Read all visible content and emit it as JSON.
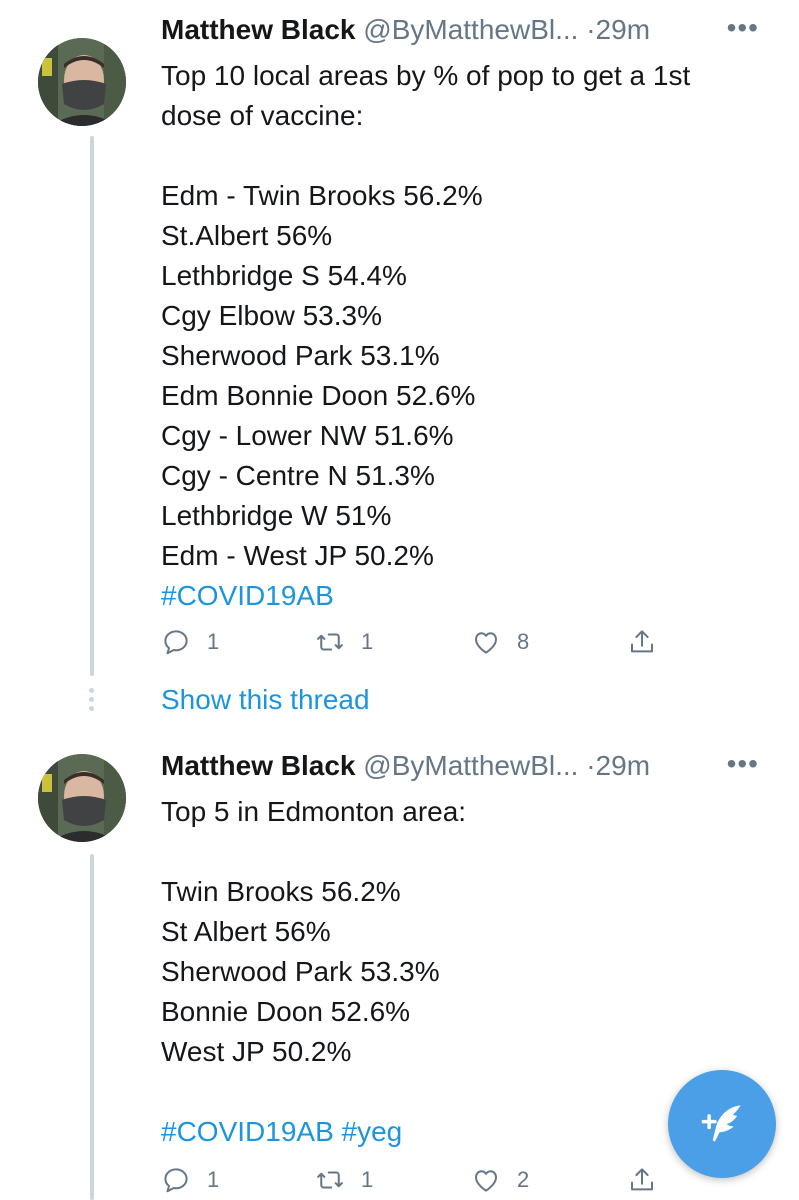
{
  "tweets": [
    {
      "name": "Matthew Black",
      "handle": "@ByMatthewBl...",
      "time": "·29m",
      "more": "•••",
      "lines": [
        "Top 10 local areas by % of pop to get a 1st",
        "dose of vaccine:",
        "",
        "Edm - Twin Brooks 56.2%",
        "St.Albert 56%",
        "Lethbridge S 54.4%",
        "Cgy Elbow 53.3%",
        "Sherwood Park 53.1%",
        "Edm Bonnie Doon 52.6%",
        "Cgy - Lower NW 51.6%",
        "Cgy - Centre N 51.3%",
        "Lethbridge W 51%",
        "Edm - West JP 50.2%"
      ],
      "hashtags": "#COVID19AB",
      "reply_count": "1",
      "retweet_count": "1",
      "like_count": "8"
    },
    {
      "name": "Matthew Black",
      "handle": "@ByMatthewBl...",
      "time": "·29m",
      "more": "•••",
      "lines": [
        "Top 5 in Edmonton area:",
        "",
        "Twin Brooks 56.2%",
        "St Albert 56%",
        "Sherwood Park 53.3%",
        "Bonnie Doon 52.6%",
        "West JP 50.2%",
        ""
      ],
      "hashtags": "#COVID19AB #yeg",
      "reply_count": "1",
      "retweet_count": "1",
      "like_count": "2"
    }
  ],
  "show_thread": "Show this thread",
  "icons": {
    "reply": "reply-icon",
    "retweet": "retweet-icon",
    "like": "heart-icon",
    "share": "share-icon",
    "compose": "compose-tweet-icon"
  },
  "colors": {
    "link": "#1b95e0",
    "muted": "#657786",
    "fab": "#4a9fe6"
  }
}
